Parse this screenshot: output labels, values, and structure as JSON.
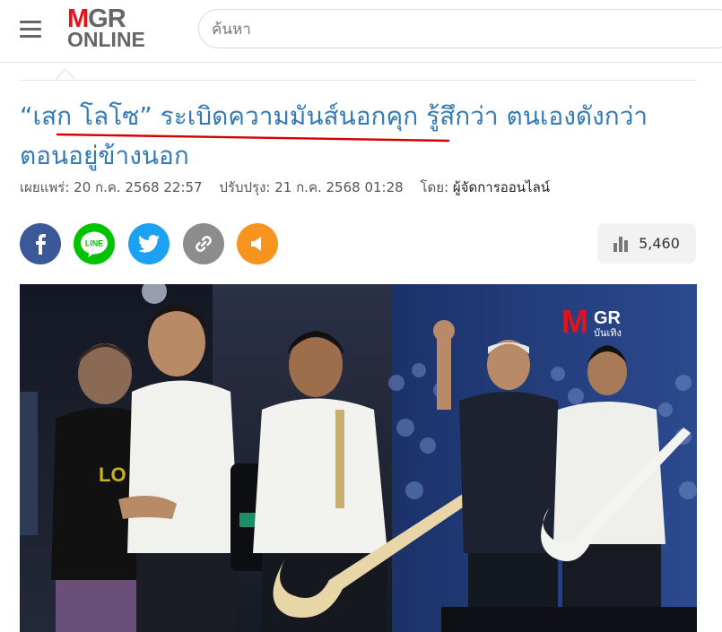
{
  "header": {
    "logo_m": "M",
    "logo_gr": "GR",
    "logo_online": "ONLINE",
    "search_placeholder": "ค้นหา"
  },
  "article": {
    "title": "“เสก โลโซ” ระเบิดความมันส์นอกคุก รู้สึกว่า ตนเองดังกว่าตอนอยู่ข้างนอก",
    "published_label": "เผยแพร่:",
    "published": "20 ก.ค. 2568 22:57",
    "updated_label": "ปรับปรุง:",
    "updated": "21 ก.ค. 2568 01:28",
    "by_label": "โดย:",
    "author": "ผู้จัดการออนไลน์"
  },
  "share": {
    "icons": [
      "facebook-icon",
      "line-icon",
      "twitter-icon",
      "link-icon",
      "megaphone-icon"
    ],
    "line_text": "LINE",
    "colors": {
      "facebook": "#3b5998",
      "line": "#00c300",
      "twitter": "#1da1f2",
      "link": "#8c8c8c",
      "megaphone": "#f7941d"
    },
    "views": "5,460"
  },
  "photo": {
    "watermark_m": "M",
    "watermark_gr": "GR",
    "watermark_sub": "บันเทิง"
  },
  "colors": {
    "headline": "#337ab7",
    "brand_red": "#e3121b"
  }
}
